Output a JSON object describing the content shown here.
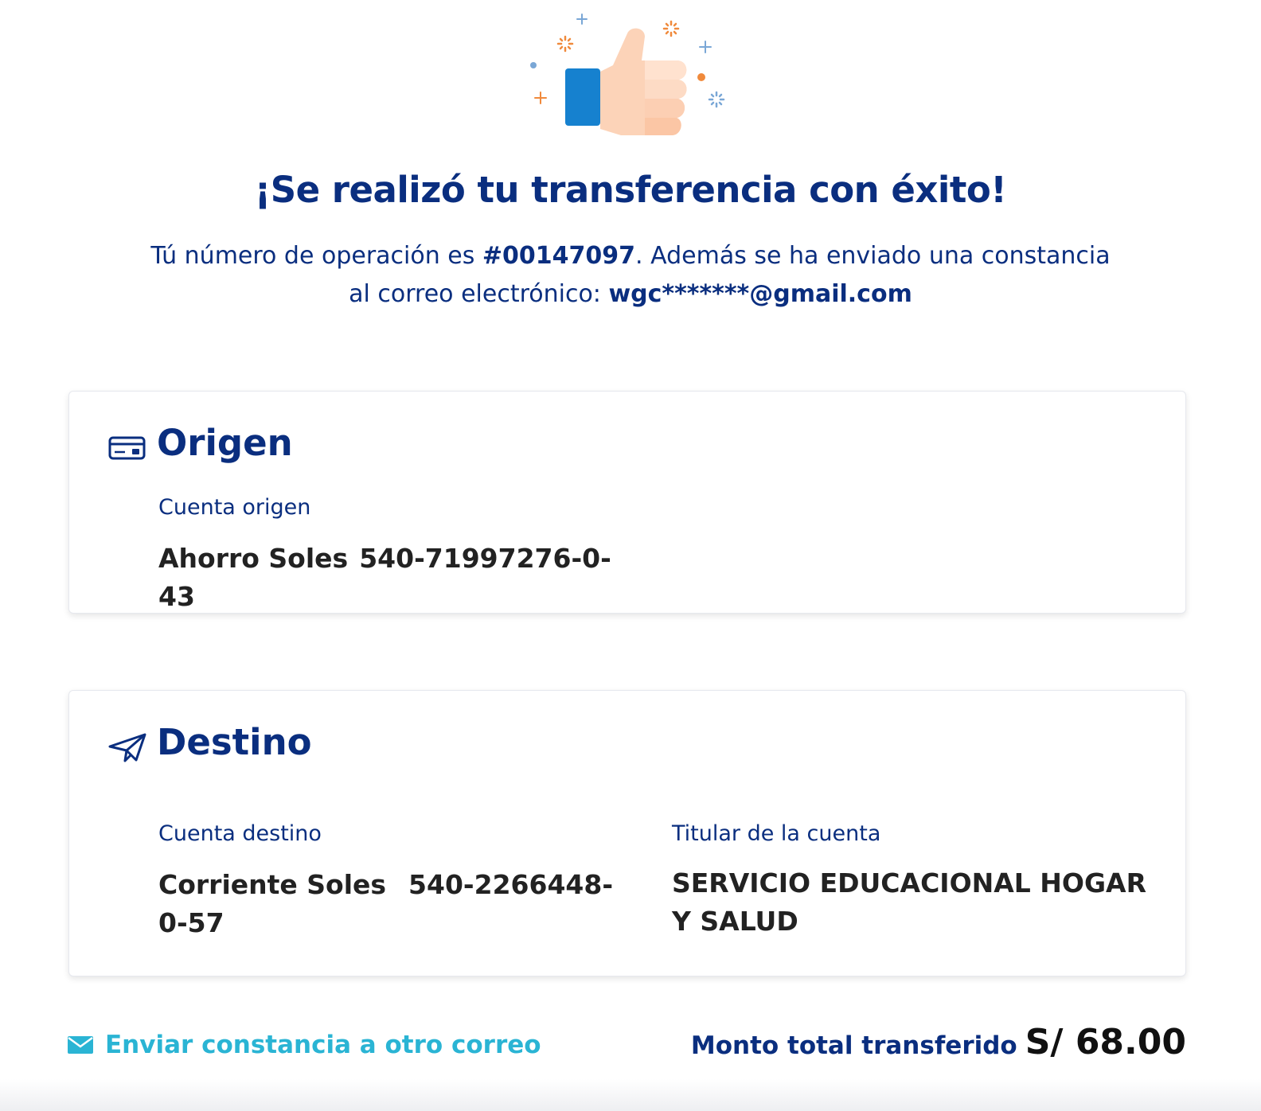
{
  "header": {
    "title": "¡Se realizó tu transferencia con éxito!",
    "message_prefix": "Tú número de operación es ",
    "operation_number": "#00147097",
    "message_middle": ". Además se ha enviado una constancia al correo electrónico: ",
    "email": "wgc*******@gmail.com",
    "illustration_icon": "thumbs-up-icon"
  },
  "origen": {
    "title": "Origen",
    "icon": "card-icon",
    "account_label": "Cuenta origen",
    "account_type": "Ahorro Soles",
    "account_number": "540-71997276-0-43"
  },
  "destino": {
    "title": "Destino",
    "icon": "paper-plane-icon",
    "account_label": "Cuenta destino",
    "account_type": "Corriente Soles",
    "account_number": "540-2266448-0-57",
    "holder_label": "Titular de la cuenta",
    "holder_name": "SERVICIO EDUCACIONAL HOGAR Y SALUD"
  },
  "footer": {
    "send_link_label": "Enviar constancia a otro correo",
    "send_link_icon": "mail-icon",
    "total_label": "Monto total transferido",
    "total_amount": "S/ 68.00"
  },
  "colors": {
    "primary": "#0a2e7f",
    "link": "#2ab4d4",
    "accent_blue": "#1681cf",
    "accent_orange": "#f08a3c"
  }
}
